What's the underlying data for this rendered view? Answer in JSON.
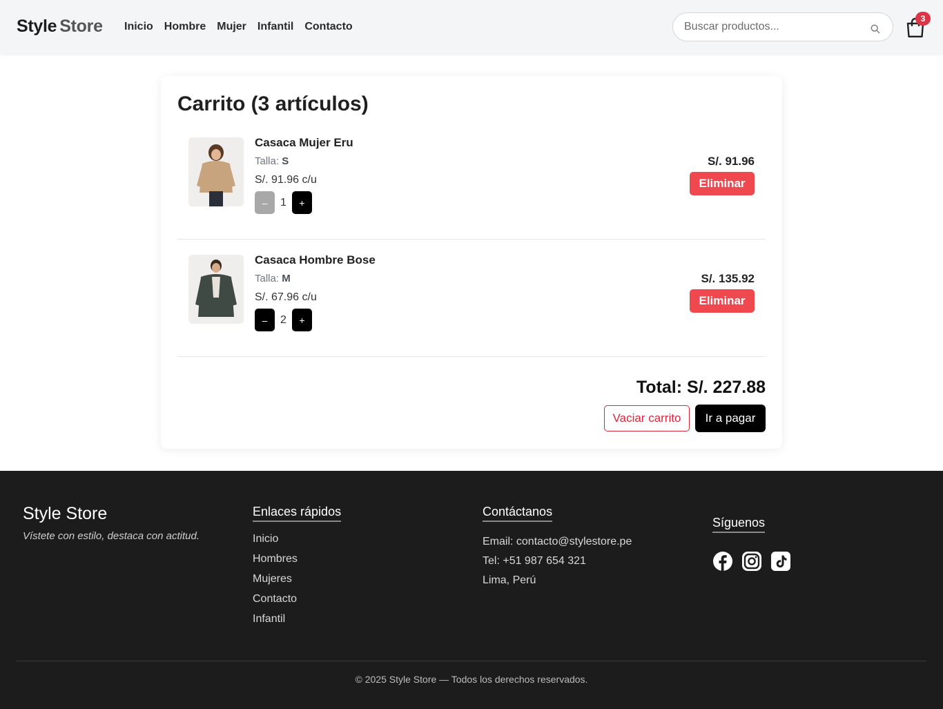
{
  "header": {
    "brand_part1": "Style",
    "brand_part2": "Store",
    "nav": [
      "Inicio",
      "Hombre",
      "Mujer",
      "Infantil",
      "Contacto"
    ],
    "search_placeholder": "Buscar productos...",
    "cart_count": "3"
  },
  "cart": {
    "title": "Carrito (3 artículos)",
    "size_label": "Talla:",
    "items": [
      {
        "name": "Casaca Mujer Eru",
        "size": "S",
        "unit_price": "S/. 91.96 c/u",
        "quantity": "1",
        "subtotal": "S/. 91.96",
        "remove_label": "Eliminar",
        "minus": "–",
        "plus": "+"
      },
      {
        "name": "Casaca Hombre Bose",
        "size": "M",
        "unit_price": "S/. 67.96 c/u",
        "quantity": "2",
        "subtotal": "S/. 135.92",
        "remove_label": "Eliminar",
        "minus": "–",
        "plus": "+"
      }
    ],
    "total": "Total: S/. 227.88",
    "empty_label": "Vaciar carrito",
    "pay_label": "Ir a pagar"
  },
  "footer": {
    "brand": "Style Store",
    "tagline": "Vístete con estilo, destaca con actitud.",
    "links_title": "Enlaces rápidos",
    "links": [
      "Inicio",
      "Hombres",
      "Mujeres",
      "Contacto",
      "Infantil"
    ],
    "contact_title": "Contáctanos",
    "email": "Email: contacto@stylestore.pe",
    "phone": "Tel: +51 987 654 321",
    "location": "Lima, Perú",
    "social_title": "Síguenos",
    "social_icons": [
      "facebook-icon",
      "instagram-icon",
      "tiktok-icon"
    ],
    "copyright": "© 2025 Style Store — Todos los derechos reservados."
  },
  "colors": {
    "header_bg": "#f4f5f6",
    "footer_bg": "#1c1c1c",
    "danger": "#f0484f",
    "badge": "#dc3545",
    "primary_button": "#000000"
  }
}
